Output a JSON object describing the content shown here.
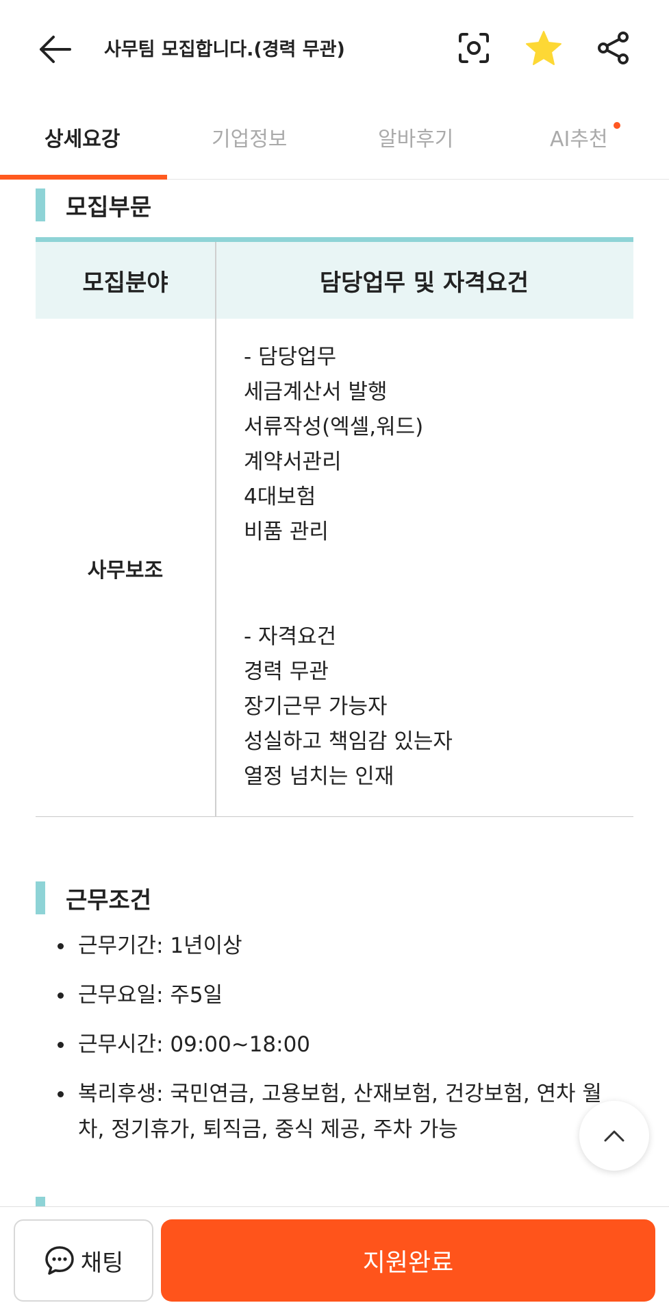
{
  "header": {
    "title": "사무팀 모집합니다.(경력 무관)",
    "back_icon": "arrow-left-icon",
    "scan_icon": "scan-icon",
    "star_icon": "star-icon",
    "share_icon": "share-icon",
    "star_color": "#fdd835"
  },
  "tabs": [
    {
      "label": "상세요강",
      "active": true
    },
    {
      "label": "기업정보",
      "active": false
    },
    {
      "label": "알바후기",
      "active": false
    },
    {
      "label": "AI추천",
      "active": false,
      "badge": true
    }
  ],
  "recruit_section": {
    "title": "모집부문",
    "table": {
      "headers": [
        "모집분야",
        "담당업무 및 자격요건"
      ],
      "rows": [
        {
          "field": "사무보조",
          "lines": [
            "- 담당업무",
            "세금계산서 발행",
            "서류작성(엑셀,워드)",
            "계약서관리",
            "4대보험",
            "비품 관리",
            "",
            "",
            "- 자격요건",
            "경력 무관",
            "장기근무 가능자",
            "성실하고 책임감 있는자",
            "열정 넘치는 인재"
          ]
        }
      ]
    }
  },
  "conditions_section": {
    "title": "근무조건",
    "items": [
      "근무기간: 1년이상",
      "근무요일: 주5일",
      "근무시간: 09:00~18:00",
      "복리후생: 국민연금, 고용보험, 산재보험, 건강보험, 연차 월차, 정기휴가, 퇴직금, 중식 제공, 주차 가능"
    ]
  },
  "bottom_bar": {
    "chat_label": "채팅",
    "apply_label": "지원완료",
    "accent_color": "#ff541b"
  }
}
